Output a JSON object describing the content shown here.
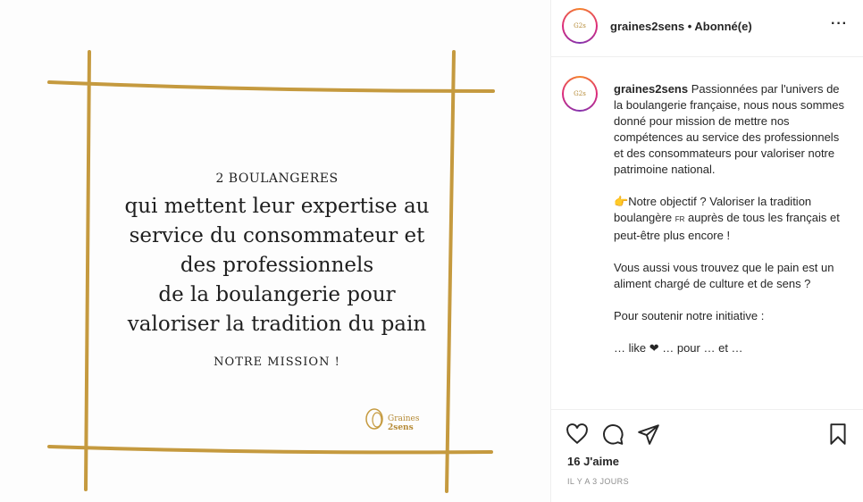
{
  "slide": {
    "top": "2 BOULANGERES",
    "lines": [
      "qui mettent leur expertise au",
      "service du consommateur et",
      "des professionnels",
      "de la boulangerie pour",
      "valoriser la tradition du pain"
    ],
    "bottom": "NOTRE MISSION !",
    "logo_line1": "Graines",
    "logo_line2": "2sens",
    "frame_color": "#c59a3f"
  },
  "header": {
    "username": "graines2sens",
    "separator": " • ",
    "follow_status": "Abonné(e)",
    "more": "···",
    "avatar_text": "Graines 2sens"
  },
  "caption": {
    "username": "graines2sens",
    "intro": "Passionnées par l'univers de la boulangerie française, nous nous sommes donné pour mission de mettre nos compétences au service des professionnels et des consommateurs pour valoriser notre patrimoine national.",
    "objective_emoji": "👉",
    "objective_a": "Notre objectif ? Valoriser la tradition boulangère",
    "flag": "FR",
    "objective_b": "auprès de tous les français et peut-être plus encore !",
    "question": "Vous aussi vous trouvez que le pain est un aliment chargé de culture et de sens ?",
    "support": "Pour soutenir notre initiative :",
    "cut_line": "… like ❤ … pour … et …"
  },
  "actions": {
    "like_icon": "heart-icon",
    "comment_icon": "comment-icon",
    "share_icon": "send-icon",
    "save_icon": "bookmark-icon"
  },
  "likes": "16 J'aime",
  "time": "IL Y A 3 JOURS"
}
